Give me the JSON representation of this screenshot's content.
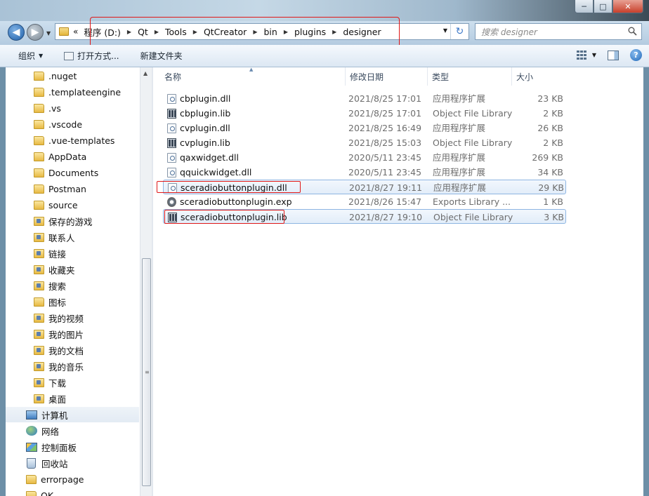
{
  "window": {
    "controls": {
      "minimize": "─",
      "maximize": "□",
      "close": "✕"
    }
  },
  "nav": {
    "back_glyph": "◀",
    "forward_glyph": "▶",
    "breadcrumb_overflow": "«",
    "breadcrumbs": [
      "程序 (D:)",
      "Qt",
      "Tools",
      "QtCreator",
      "bin",
      "plugins",
      "designer"
    ],
    "search_placeholder": "搜索 designer",
    "refresh_glyph": "↻"
  },
  "toolbar": {
    "organize": "组织",
    "open_with": "打开方式...",
    "new_folder": "新建文件夹",
    "help": "?"
  },
  "sidebar": {
    "items": [
      {
        "label": ".nuget",
        "icon": "folder-icon"
      },
      {
        "label": ".templateengine",
        "icon": "folder-icon"
      },
      {
        "label": ".vs",
        "icon": "folder-icon"
      },
      {
        "label": ".vscode",
        "icon": "folder-icon"
      },
      {
        "label": ".vue-templates",
        "icon": "folder-icon"
      },
      {
        "label": "AppData",
        "icon": "folder-icon"
      },
      {
        "label": "Documents",
        "icon": "folder-icon"
      },
      {
        "label": "Postman",
        "icon": "folder-icon"
      },
      {
        "label": "source",
        "icon": "folder-icon"
      },
      {
        "label": "保存的游戏",
        "icon": "special-folder-icon"
      },
      {
        "label": "联系人",
        "icon": "special-folder-icon"
      },
      {
        "label": "链接",
        "icon": "special-folder-icon"
      },
      {
        "label": "收藏夹",
        "icon": "special-folder-icon"
      },
      {
        "label": "搜索",
        "icon": "special-folder-icon"
      },
      {
        "label": "图标",
        "icon": "folder-icon"
      },
      {
        "label": "我的视频",
        "icon": "special-folder-icon"
      },
      {
        "label": "我的图片",
        "icon": "special-folder-icon"
      },
      {
        "label": "我的文档",
        "icon": "special-folder-icon"
      },
      {
        "label": "我的音乐",
        "icon": "special-folder-icon"
      },
      {
        "label": "下载",
        "icon": "special-folder-icon"
      },
      {
        "label": "桌面",
        "icon": "special-folder-icon"
      },
      {
        "label": "计算机",
        "icon": "computer-icon"
      },
      {
        "label": "网络",
        "icon": "network-icon"
      },
      {
        "label": "控制面板",
        "icon": "control-panel-icon"
      },
      {
        "label": "回收站",
        "icon": "recycle-bin-icon"
      },
      {
        "label": "errorpage",
        "icon": "folder-icon"
      },
      {
        "label": "OK",
        "icon": "folder-icon"
      }
    ]
  },
  "columns": {
    "name": "名称",
    "date": "修改日期",
    "type": "类型",
    "size": "大小"
  },
  "files": [
    {
      "name": "cbplugin.dll",
      "date": "2021/8/25 17:01",
      "type": "应用程序扩展",
      "size": "23 KB",
      "icon": "dll-icon"
    },
    {
      "name": "cbplugin.lib",
      "date": "2021/8/25 17:01",
      "type": "Object File Library",
      "size": "2 KB",
      "icon": "lib-icon"
    },
    {
      "name": "cvplugin.dll",
      "date": "2021/8/25 16:49",
      "type": "应用程序扩展",
      "size": "26 KB",
      "icon": "dll-icon"
    },
    {
      "name": "cvplugin.lib",
      "date": "2021/8/25 15:03",
      "type": "Object File Library",
      "size": "2 KB",
      "icon": "lib-icon"
    },
    {
      "name": "qaxwidget.dll",
      "date": "2020/5/11 23:45",
      "type": "应用程序扩展",
      "size": "269 KB",
      "icon": "dll-icon"
    },
    {
      "name": "qquickwidget.dll",
      "date": "2020/5/11 23:45",
      "type": "应用程序扩展",
      "size": "34 KB",
      "icon": "dll-icon"
    },
    {
      "name": "sceradiobuttonplugin.dll",
      "date": "2021/8/27 19:11",
      "type": "应用程序扩展",
      "size": "29 KB",
      "icon": "dll-icon",
      "selected": true
    },
    {
      "name": "sceradiobuttonplugin.exp",
      "date": "2021/8/26 15:47",
      "type": "Exports Library ...",
      "size": "1 KB",
      "icon": "exp-icon"
    },
    {
      "name": "sceradiobuttonplugin.lib",
      "date": "2021/8/27 19:10",
      "type": "Object File Library",
      "size": "3 KB",
      "icon": "lib-icon",
      "selected": true
    }
  ],
  "colors": {
    "highlight_red": "#e01818",
    "selection_border": "#8eb5e2"
  }
}
